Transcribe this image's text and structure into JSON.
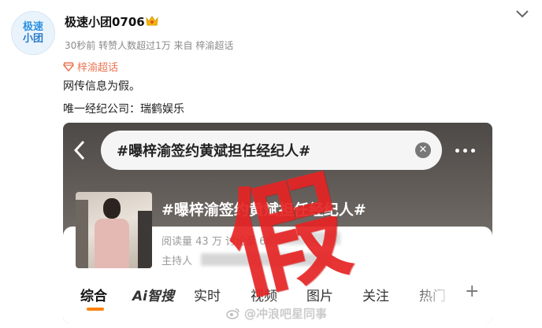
{
  "post": {
    "avatar_text_top": "极速",
    "avatar_text_bottom": "小团",
    "username": "极速小团0706",
    "meta": "30秒前  转赞人数超过1万  来自 梓渝超话",
    "supertopic": "梓渝超话",
    "line1": "网传信息为假。",
    "line2": "唯一经纪公司：瑞鹤娱乐"
  },
  "screenshot": {
    "search_text": "#曝梓渝签约黄斌担任经纪人#",
    "topic_title": "#曝梓渝签约黄斌担任经纪人#",
    "stats_prefix": "阅读量 43",
    "stats_mid": "万  讨论量",
    "stats_tail": "66",
    "host_label": "主持人",
    "tabs": [
      "综合",
      "Ai智搜",
      "实时",
      "视频",
      "图片",
      "关注",
      "热门"
    ],
    "stamp": "假"
  },
  "watermark": "@冲浪吧星同事",
  "colors": {
    "accent_orange": "#ff8200",
    "supertopic": "#eb7350",
    "stamp_red": "#e62626"
  }
}
